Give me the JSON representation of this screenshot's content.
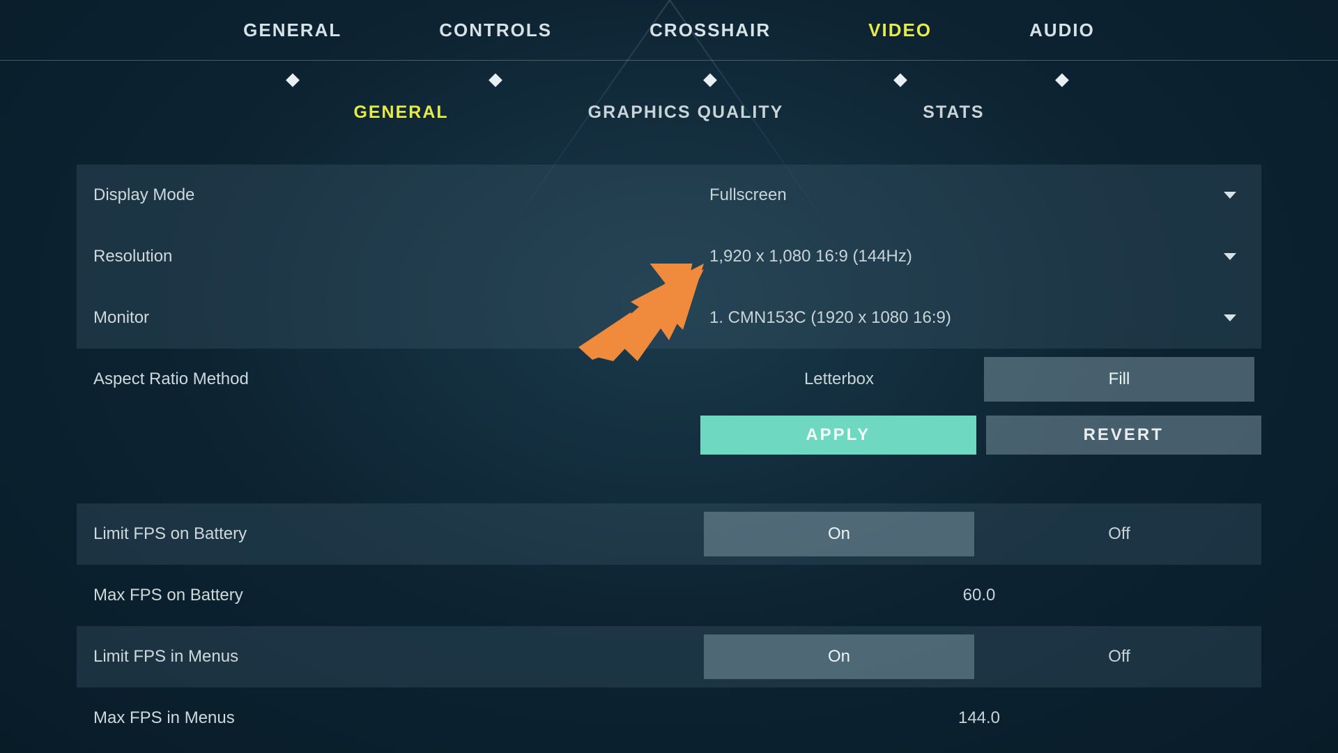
{
  "topTabs": [
    {
      "label": "GENERAL"
    },
    {
      "label": "CONTROLS"
    },
    {
      "label": "CROSSHAIR"
    },
    {
      "label": "VIDEO",
      "active": true
    },
    {
      "label": "AUDIO"
    }
  ],
  "subTabs": [
    {
      "label": "GENERAL",
      "active": true
    },
    {
      "label": "GRAPHICS QUALITY"
    },
    {
      "label": "STATS"
    }
  ],
  "settings": {
    "displayMode": {
      "label": "Display Mode",
      "value": "Fullscreen"
    },
    "resolution": {
      "label": "Resolution",
      "value": "1,920 x 1,080 16:9 (144Hz)"
    },
    "monitor": {
      "label": "Monitor",
      "value": "1. CMN153C (1920 x  1080 16:9)"
    },
    "aspectRatio": {
      "label": "Aspect Ratio Method",
      "optA": "Letterbox",
      "optB": "Fill",
      "selected": "A"
    },
    "apply": "APPLY",
    "revert": "REVERT",
    "limitFpsBattery": {
      "label": "Limit FPS on Battery",
      "optA": "On",
      "optB": "Off",
      "selected": "A"
    },
    "maxFpsBattery": {
      "label": "Max FPS on Battery",
      "value": "60.0"
    },
    "limitFpsMenus": {
      "label": "Limit FPS in Menus",
      "optA": "On",
      "optB": "Off",
      "selected": "A"
    },
    "maxFpsMenus": {
      "label": "Max FPS in Menus",
      "value": "144.0"
    }
  }
}
